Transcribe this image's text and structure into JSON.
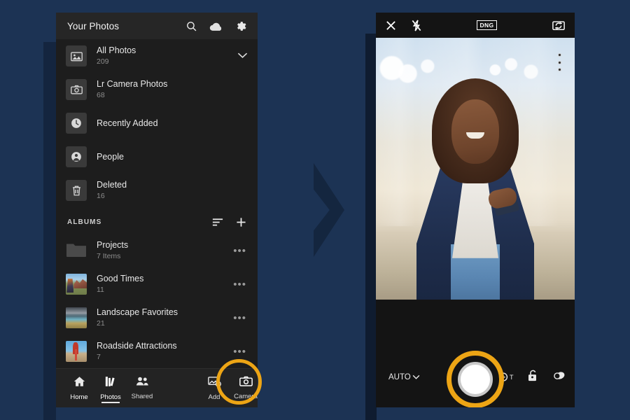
{
  "background": {
    "color": "#1c3354",
    "arrow_icon": "chevron-right-arrow"
  },
  "left_panel": {
    "header": {
      "title": "Your Photos",
      "icons": [
        {
          "name": "search-icon",
          "glyph": "search"
        },
        {
          "name": "cloud-icon",
          "glyph": "cloud"
        },
        {
          "name": "settings-gear-icon",
          "glyph": "gear"
        }
      ]
    },
    "nav_items": [
      {
        "label": "All Photos",
        "count": "209",
        "icon": "photo-library-icon",
        "chevron": true
      },
      {
        "label": "Lr Camera Photos",
        "count": "68",
        "icon": "camera-icon",
        "chevron": false
      },
      {
        "label": "Recently Added",
        "count": "",
        "icon": "clock-icon",
        "chevron": false
      },
      {
        "label": "People",
        "count": "",
        "icon": "person-icon",
        "chevron": false
      },
      {
        "label": "Deleted",
        "count": "16",
        "icon": "trash-icon",
        "chevron": false
      }
    ],
    "albums_section": {
      "title": "ALBUMS",
      "sort_icon": "sort-lines-icon",
      "add_icon": "plus-icon",
      "albums": [
        {
          "name": "Projects",
          "count": "7 Items",
          "thumb": "folder-icon",
          "more": "•••"
        },
        {
          "name": "Good Times",
          "count": "11",
          "thumb": "photo-thumb-hikers",
          "more": "•••"
        },
        {
          "name": "Landscape Favorites",
          "count": "21",
          "thumb": "photo-thumb-lake",
          "more": "•••"
        },
        {
          "name": "Roadside Attractions",
          "count": "7",
          "thumb": "photo-thumb-roadside",
          "more": "•••"
        }
      ]
    },
    "tabbar": [
      {
        "label": "Home",
        "icon": "home-icon",
        "active": false
      },
      {
        "label": "Photos",
        "icon": "books-icon",
        "active": true
      },
      {
        "label": "Shared",
        "icon": "people-icon",
        "active": false
      },
      {
        "label": "Add",
        "icon": "add-photo-icon",
        "active": false
      },
      {
        "label": "Camera",
        "icon": "camera-icon",
        "active": false,
        "highlighted": true
      }
    ],
    "highlight_color": "#eda515"
  },
  "right_panel": {
    "topbar": {
      "close_icon": "close-x-icon",
      "flash_off_icon": "flash-off-icon",
      "format_badge": "DNG",
      "flip_camera_icon": "camera-flip-icon"
    },
    "viewfinder": {
      "level_indicator_icon": "level-indicator-icon",
      "subject_description": "Smiling woman in navy blazer holding a tablet in a bright glass lobby"
    },
    "controls": {
      "mode_label": "AUTO",
      "mode_chevron_icon": "chevron-down-icon",
      "shutter_icon": "shutter-button",
      "timer_label": "T",
      "timer_icon": "timer-icon",
      "lock_icon": "unlock-padlock-icon",
      "preset_icon": "preset-exposure-icon"
    },
    "highlight_color": "#eda515"
  }
}
